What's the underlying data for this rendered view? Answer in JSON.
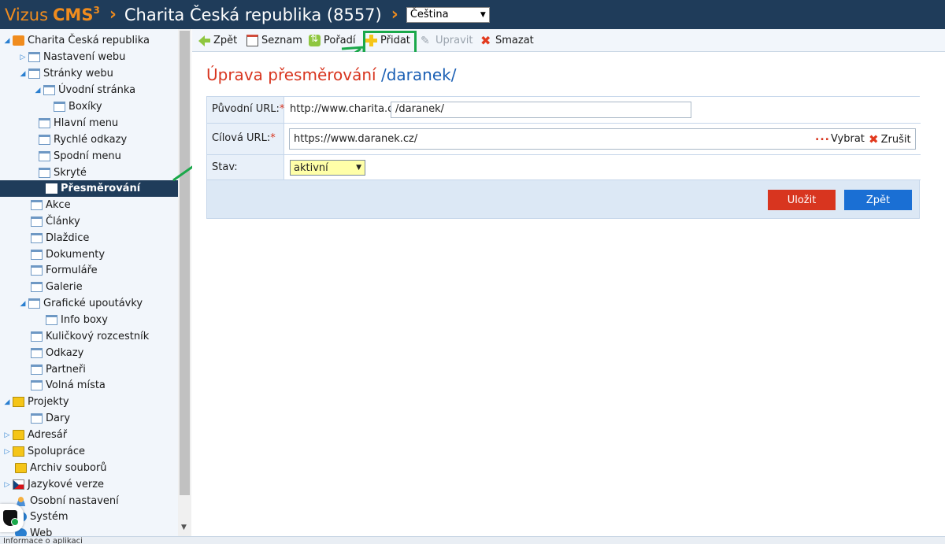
{
  "header": {
    "brand_name": "Vizus",
    "brand_cms": "CMS",
    "brand_sup": "3",
    "separator": "›",
    "site_title": "Charita Česká republika (8557)",
    "language_selected": "Čeština"
  },
  "sidebar": {
    "items": [
      {
        "label": "Charita Česká republika",
        "icon": "cube-icon"
      },
      {
        "label": "Nastavení webu",
        "icon": "page-icon"
      },
      {
        "label": "Stránky webu",
        "icon": "page-icon"
      },
      {
        "label": "Úvodní stránka",
        "icon": "page-icon"
      },
      {
        "label": "Boxíky",
        "icon": "page-icon"
      },
      {
        "label": "Hlavní menu",
        "icon": "page-icon"
      },
      {
        "label": "Rychlé odkazy",
        "icon": "page-icon"
      },
      {
        "label": "Spodní menu",
        "icon": "page-icon"
      },
      {
        "label": "Skryté",
        "icon": "page-icon"
      },
      {
        "label": "Přesměrování",
        "icon": "page-icon",
        "active": true
      },
      {
        "label": "Akce",
        "icon": "page-icon"
      },
      {
        "label": "Články",
        "icon": "page-icon"
      },
      {
        "label": "Dlaždice",
        "icon": "page-icon"
      },
      {
        "label": "Dokumenty",
        "icon": "page-icon"
      },
      {
        "label": "Formuláře",
        "icon": "page-icon"
      },
      {
        "label": "Galerie",
        "icon": "page-icon"
      },
      {
        "label": "Grafické upoutávky",
        "icon": "page-icon"
      },
      {
        "label": "Info boxy",
        "icon": "page-icon"
      },
      {
        "label": "Kuličkový rozcestník",
        "icon": "page-icon"
      },
      {
        "label": "Odkazy",
        "icon": "page-icon"
      },
      {
        "label": "Partneři",
        "icon": "page-icon"
      },
      {
        "label": "Volná místa",
        "icon": "page-icon"
      },
      {
        "label": "Projekty",
        "icon": "projects-icon"
      },
      {
        "label": "Dary",
        "icon": "page-icon"
      },
      {
        "label": "Adresář",
        "icon": "folder-icon"
      },
      {
        "label": "Spolupráce",
        "icon": "projects-icon"
      },
      {
        "label": "Archiv souborů",
        "icon": "folder-icon"
      },
      {
        "label": "Jazykové verze",
        "icon": "flag-icon"
      },
      {
        "label": "Osobní nastavení",
        "icon": "user-icon"
      },
      {
        "label": "Systém",
        "icon": "system-icon"
      },
      {
        "label": "Web",
        "icon": "web-icon"
      }
    ],
    "footer_text": "Informace o aplikaci"
  },
  "toolbar": {
    "back_label": "Zpět",
    "list_label": "Seznam",
    "order_label": "Pořadí",
    "add_label": "Přidat",
    "edit_label": "Upravit",
    "delete_label": "Smazat"
  },
  "main": {
    "title_prefix": "Úprava přesměrování",
    "title_path": "/daranek/",
    "form": {
      "source_label": "Původní URL:",
      "source_prefix": "http://www.charita.cz",
      "source_value": "/daranek/",
      "target_label": "Cílová URL:",
      "target_value": "https://www.daranek.cz/",
      "target_dots": "...",
      "choose_label": "Vybrat",
      "cancel_label": "Zrušit",
      "state_label": "Stav:",
      "state_value": "aktivní",
      "required_mark": "*"
    },
    "save_button": "Uložit",
    "back_button": "Zpět"
  },
  "colors": {
    "header_bg": "#1f3c5a",
    "brand_orange": "#f08c1e",
    "title_red": "#d8351f",
    "path_blue": "#1a5fb4",
    "highlight_green": "#1aa84a"
  }
}
